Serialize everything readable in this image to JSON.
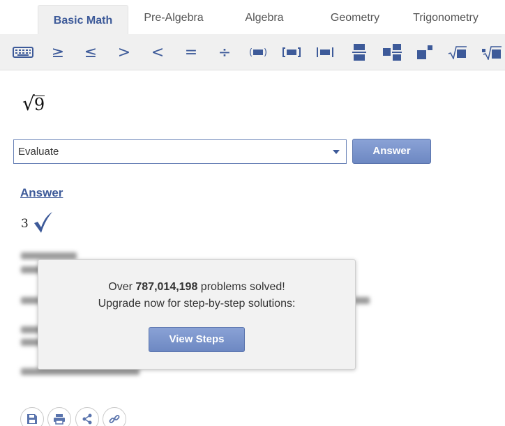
{
  "tabs": [
    {
      "label": "Basic Math",
      "active": true
    },
    {
      "label": "Pre-Algebra",
      "active": false
    },
    {
      "label": "Algebra",
      "active": false
    },
    {
      "label": "Geometry",
      "active": false
    },
    {
      "label": "Trigonometry",
      "active": false
    }
  ],
  "toolbar": {
    "symbols": [
      "keyboard-icon",
      "≥",
      "≤",
      ">",
      "<",
      "=",
      "÷",
      "paren-icon",
      "bracket-icon",
      "abs-icon",
      "fraction-icon",
      "mixed-fraction-icon",
      "exponent-icon",
      "sqrt-icon",
      "nth-root-icon"
    ]
  },
  "expression": {
    "radical": "√",
    "radicand": "9"
  },
  "problem": {
    "select_value": "Evaluate",
    "answer_button": "Answer"
  },
  "answer": {
    "heading": "Answer",
    "value": "3"
  },
  "popup": {
    "prefix": "Over ",
    "count": "787,014,198",
    "suffix": " problems solved!",
    "line2": "Upgrade now for step-by-step solutions:",
    "button": "View Steps"
  },
  "colors": {
    "accent": "#3d5a99",
    "button": "#7a93cb",
    "toolbar_bg": "#f0f0f0"
  }
}
